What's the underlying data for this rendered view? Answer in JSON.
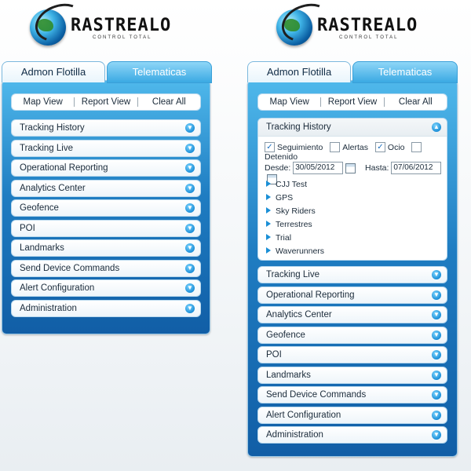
{
  "brand": {
    "name": "RASTREALO",
    "tagline": "CONTROL TOTAL"
  },
  "tabs": [
    "Admon Flotilla",
    "Telematicas"
  ],
  "toolbar": [
    "Map View",
    "Report View",
    "Clear All"
  ],
  "menu": [
    "Tracking History",
    "Tracking Live",
    "Operational Reporting",
    "Analytics Center",
    "Geofence",
    "POI",
    "Landmarks",
    "Send Device Commands",
    "Alert Configuration",
    "Administration"
  ],
  "expanded_menu_after": [
    "Tracking Live",
    "Operational Reporting",
    "Analytics Center",
    "Geofence",
    "POI",
    "Landmarks",
    "Send Device Commands",
    "Alert Configuration",
    "Administration"
  ],
  "tracking_history": {
    "title": "Tracking History",
    "filters": [
      {
        "label": "Seguimiento",
        "checked": true
      },
      {
        "label": "Alertas",
        "checked": false
      },
      {
        "label": "Ocio",
        "checked": true
      },
      {
        "label": "Detenido",
        "checked": false
      }
    ],
    "desde_label": "Desde:",
    "desde_value": "30/05/2012",
    "hasta_label": "Hasta:",
    "hasta_value": "07/06/2012",
    "groups": [
      "CJJ Test",
      "GPS",
      "Sky Riders",
      "Terrestres",
      "Trial",
      "Waverunners"
    ]
  },
  "colors": {
    "accent": "#1f7dc2",
    "tab_inactive": "#3aa9e3",
    "chevron": "#1c8fd8"
  },
  "icons": {
    "chevron": "chevron-down-icon",
    "calendar": "calendar-icon",
    "tree": "triangle-right-icon"
  }
}
